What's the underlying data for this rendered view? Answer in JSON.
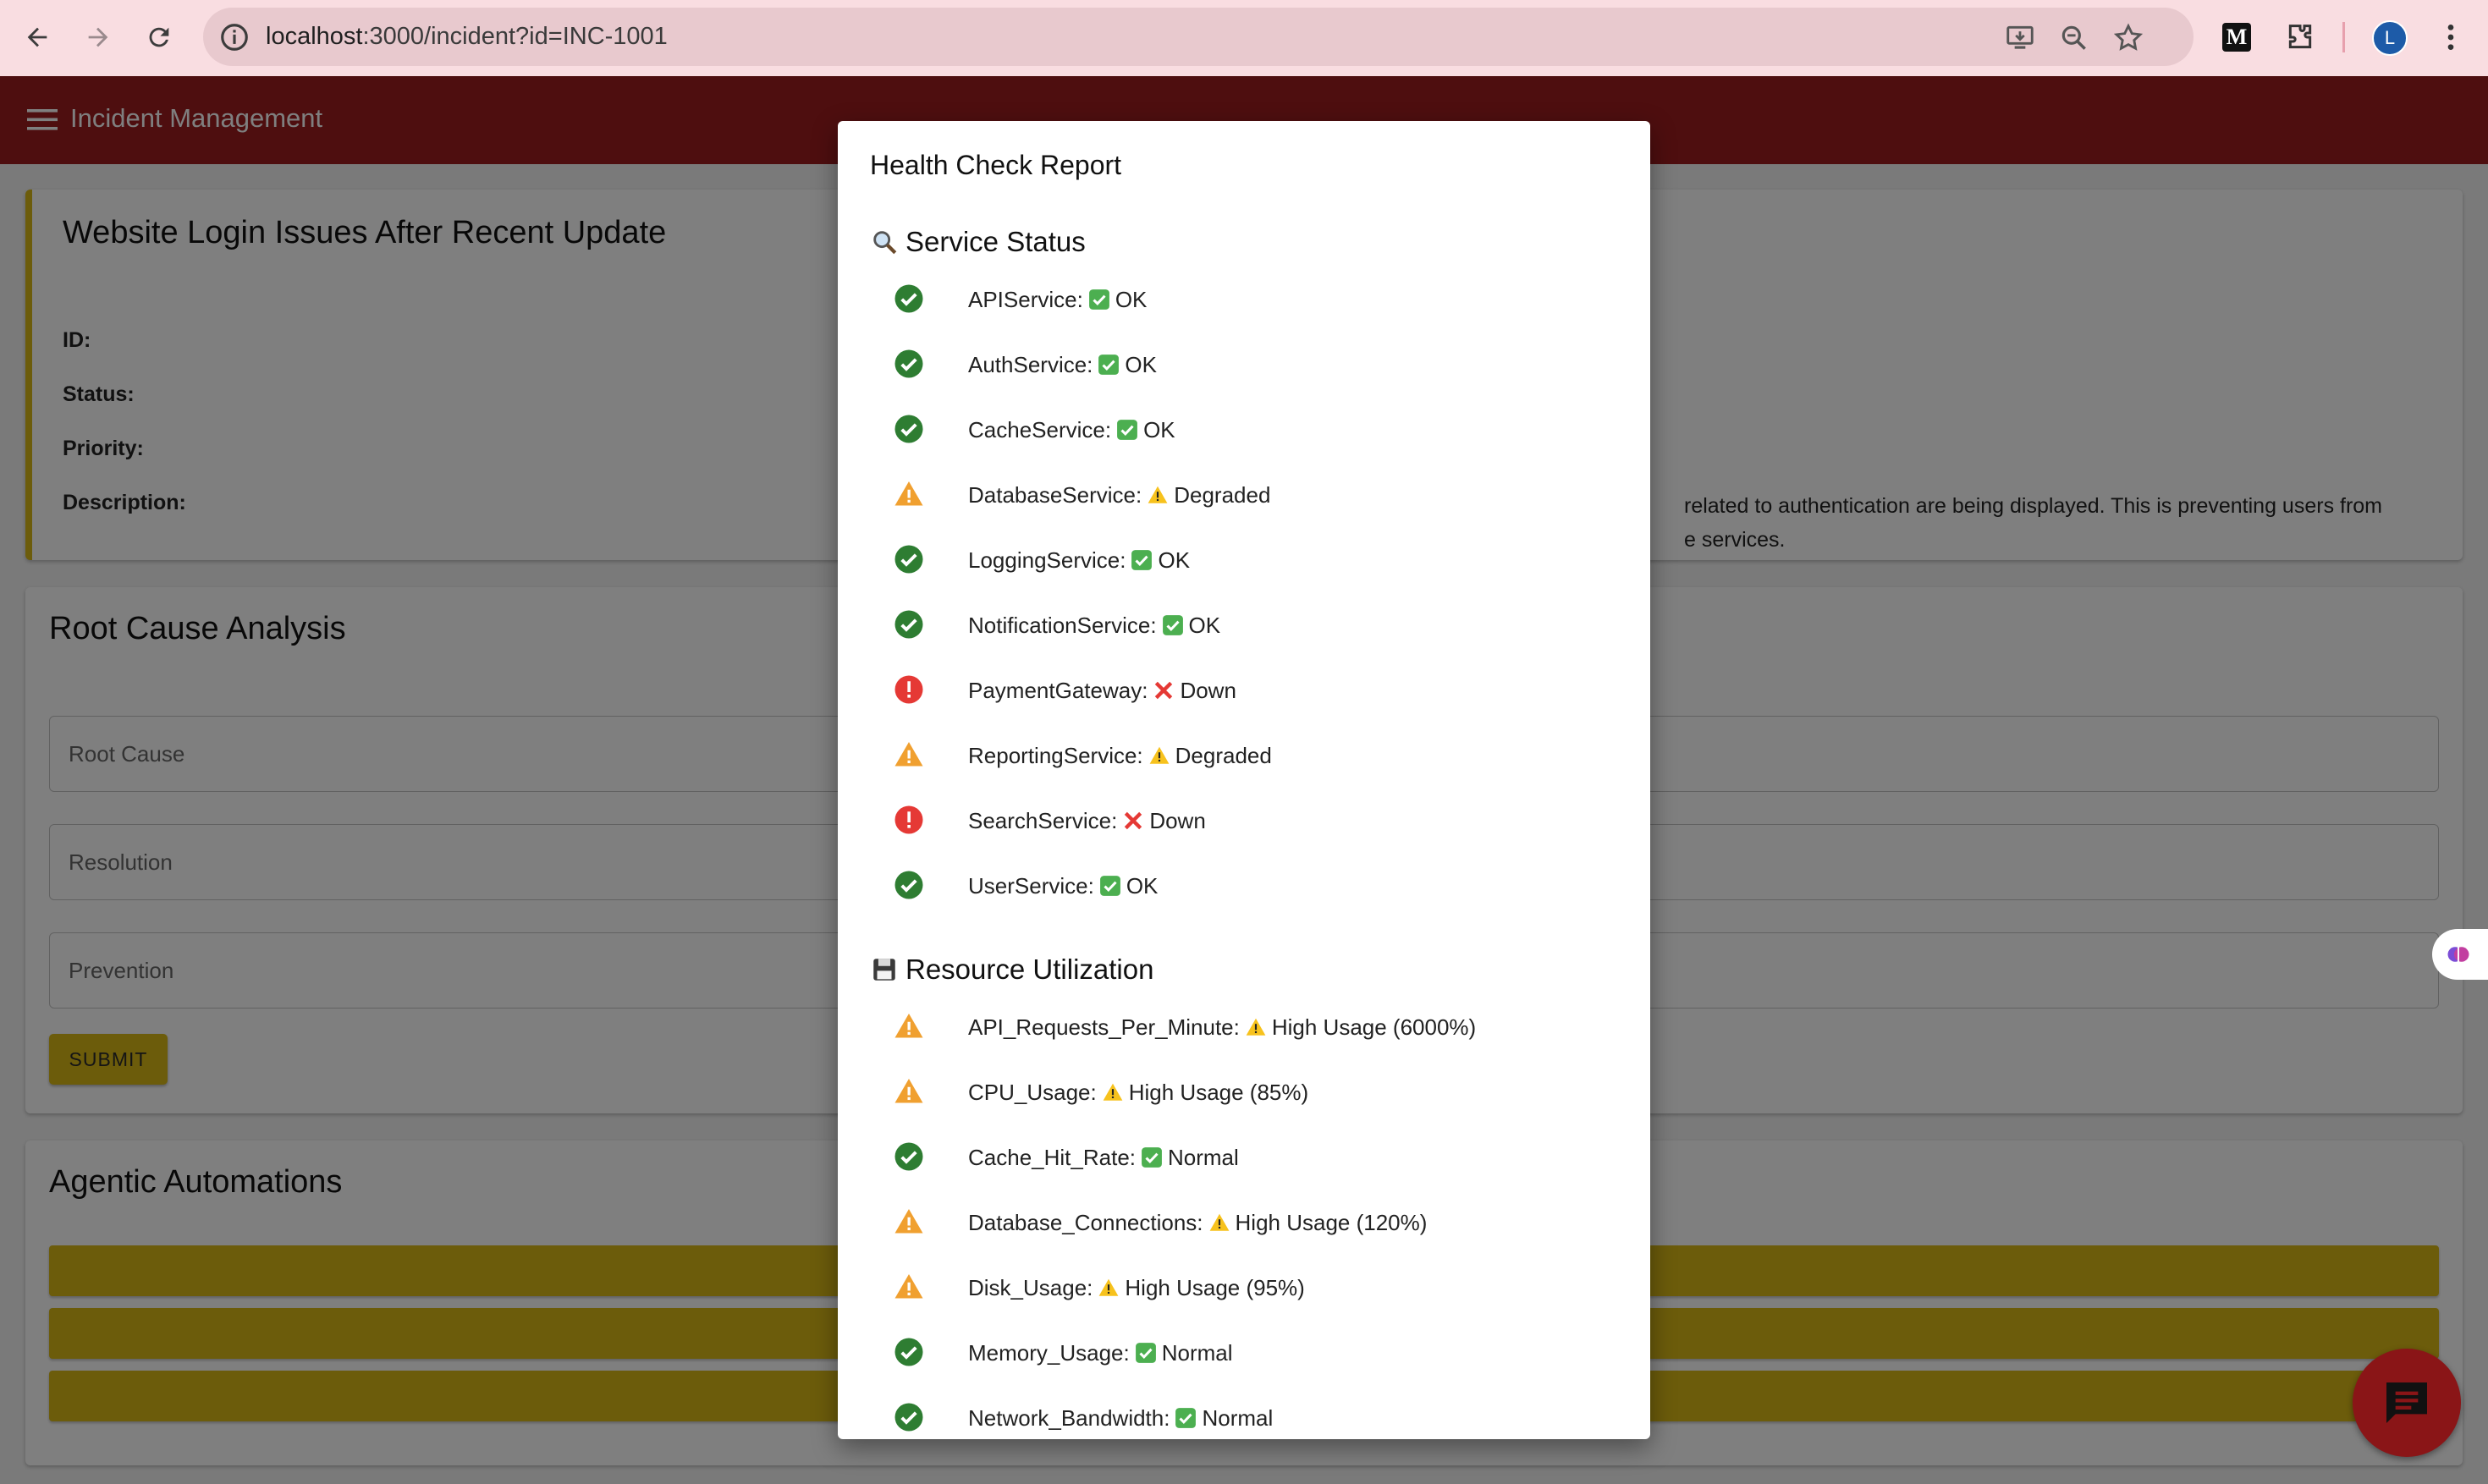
{
  "browser": {
    "url_host": "localhost",
    "url_rest": ":3000/incident?id=INC-1001",
    "avatar_letter": "L",
    "extension_letter": "M"
  },
  "app": {
    "title": "Incident Management"
  },
  "incident": {
    "title": "Website Login Issues After Recent Update",
    "labels": {
      "id": "ID:",
      "status": "Status:",
      "priority": "Priority:",
      "description": "Description:"
    },
    "description_line1": "related to authentication are being displayed. This is preventing users from",
    "description_line2": "e services."
  },
  "rca": {
    "title": "Root Cause Analysis",
    "root_cause_placeholder": "Root Cause",
    "resolution_placeholder": "Resolution",
    "prevention_placeholder": "Prevention",
    "submit_label": "SUBMIT"
  },
  "automations": {
    "title": "Agentic Automations"
  },
  "dialog": {
    "title": "Health Check Report",
    "service_section": "Service Status",
    "resource_section": "Resource Utilization",
    "services": [
      {
        "name": "APIService:",
        "status": "OK",
        "level": "ok"
      },
      {
        "name": "AuthService:",
        "status": "OK",
        "level": "ok"
      },
      {
        "name": "CacheService:",
        "status": "OK",
        "level": "ok"
      },
      {
        "name": "DatabaseService:",
        "status": "Degraded",
        "level": "warn"
      },
      {
        "name": "LoggingService:",
        "status": "OK",
        "level": "ok"
      },
      {
        "name": "NotificationService:",
        "status": "OK",
        "level": "ok"
      },
      {
        "name": "PaymentGateway:",
        "status": "Down",
        "level": "down"
      },
      {
        "name": "ReportingService:",
        "status": "Degraded",
        "level": "warn"
      },
      {
        "name": "SearchService:",
        "status": "Down",
        "level": "down"
      },
      {
        "name": "UserService:",
        "status": "OK",
        "level": "ok"
      }
    ],
    "resources": [
      {
        "name": "API_Requests_Per_Minute:",
        "status": "High Usage (6000%)",
        "level": "warn"
      },
      {
        "name": "CPU_Usage:",
        "status": "High Usage (85%)",
        "level": "warn"
      },
      {
        "name": "Cache_Hit_Rate:",
        "status": "Normal",
        "level": "ok"
      },
      {
        "name": "Database_Connections:",
        "status": "High Usage (120%)",
        "level": "warn"
      },
      {
        "name": "Disk_Usage:",
        "status": "High Usage (95%)",
        "level": "warn"
      },
      {
        "name": "Memory_Usage:",
        "status": "Normal",
        "level": "ok"
      },
      {
        "name": "Network_Bandwidth:",
        "status": "Normal",
        "level": "ok"
      }
    ]
  },
  "colors": {
    "appbar": "#9d1c1f",
    "accent_yellow": "#d9b817",
    "ok_green": "#2e7d32",
    "warn_orange": "#f0a030",
    "down_red": "#e53935"
  }
}
